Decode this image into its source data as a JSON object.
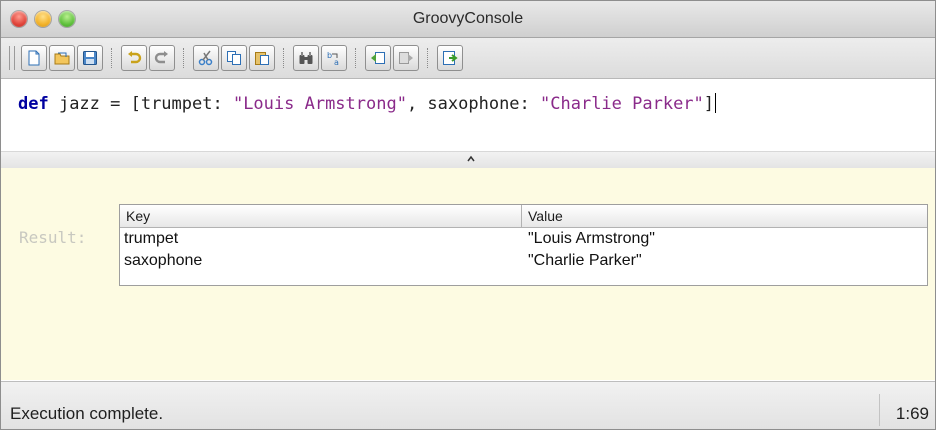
{
  "window": {
    "title": "GroovyConsole"
  },
  "toolbar": {
    "buttons": [
      {
        "name": "new-file-button",
        "icon": "new-document-icon"
      },
      {
        "name": "open-file-button",
        "icon": "open-folder-icon"
      },
      {
        "name": "save-file-button",
        "icon": "floppy-disk-icon"
      },
      {
        "name": "undo-button",
        "icon": "undo-arrow-icon"
      },
      {
        "name": "redo-button",
        "icon": "redo-arrow-icon"
      },
      {
        "name": "cut-button",
        "icon": "scissors-icon"
      },
      {
        "name": "copy-button",
        "icon": "copy-icon"
      },
      {
        "name": "paste-button",
        "icon": "paste-icon"
      },
      {
        "name": "find-button",
        "icon": "binoculars-icon"
      },
      {
        "name": "replace-button",
        "icon": "replace-icon"
      },
      {
        "name": "history-previous-button",
        "icon": "history-back-icon"
      },
      {
        "name": "history-next-button",
        "icon": "history-forward-icon"
      },
      {
        "name": "run-script-button",
        "icon": "run-icon"
      }
    ]
  },
  "editor": {
    "keyword": "def",
    "text_1": " jazz = [trumpet: ",
    "string_1": "\"Louis Armstrong\"",
    "text_2": ", saxophone: ",
    "string_2": "\"Charlie Parker\"",
    "text_3": "]"
  },
  "output": {
    "result_label": "Result:",
    "table": {
      "columns": [
        "Key",
        "Value"
      ],
      "rows": [
        {
          "key": "trumpet",
          "value": "\"Louis Armstrong\""
        },
        {
          "key": "saxophone",
          "value": "\"Charlie Parker\""
        }
      ]
    }
  },
  "status": {
    "message": "Execution complete.",
    "position": "1:69"
  }
}
